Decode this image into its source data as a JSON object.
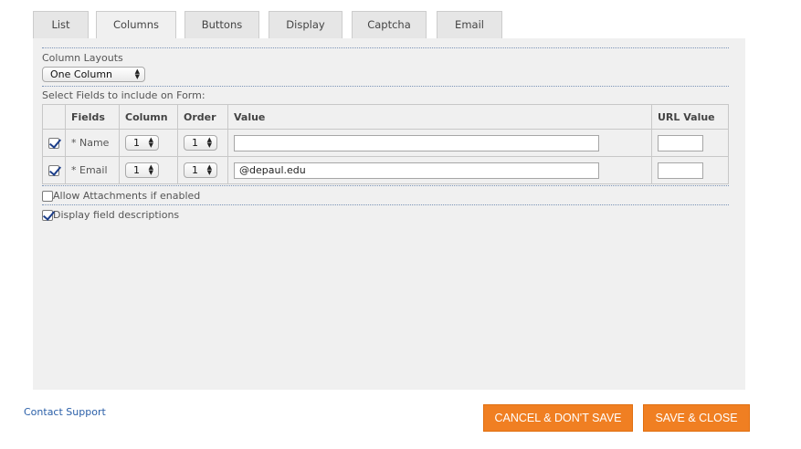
{
  "tabs": [
    {
      "label": "List"
    },
    {
      "label": "Columns"
    },
    {
      "label": "Buttons"
    },
    {
      "label": "Display"
    },
    {
      "label": "Captcha"
    },
    {
      "label": "Email"
    }
  ],
  "layout": {
    "label": "Column Layouts",
    "selected": "One Column"
  },
  "fields_section": {
    "label": "Select Fields to include on Form:",
    "headers": {
      "fields": "Fields",
      "column": "Column",
      "order": "Order",
      "value": "Value",
      "url_value": "URL Value"
    },
    "rows": [
      {
        "checked": true,
        "field": "* Name",
        "column": "1",
        "order": "1",
        "value": "",
        "url_value": ""
      },
      {
        "checked": true,
        "field": "* Email",
        "column": "1",
        "order": "1",
        "value": "@depaul.edu",
        "url_value": ""
      }
    ]
  },
  "options": {
    "attachments": {
      "label": "Allow Attachments if enabled",
      "checked": false
    },
    "descriptions": {
      "label": "Display field descriptions",
      "checked": true
    }
  },
  "footer": {
    "support_link": "Contact Support",
    "cancel_label": "CANCEL & DON'T SAVE",
    "save_label": "SAVE & CLOSE"
  },
  "colors": {
    "accent": "#f07f22",
    "link": "#2a5fa8",
    "check": "#1d3f8a"
  }
}
